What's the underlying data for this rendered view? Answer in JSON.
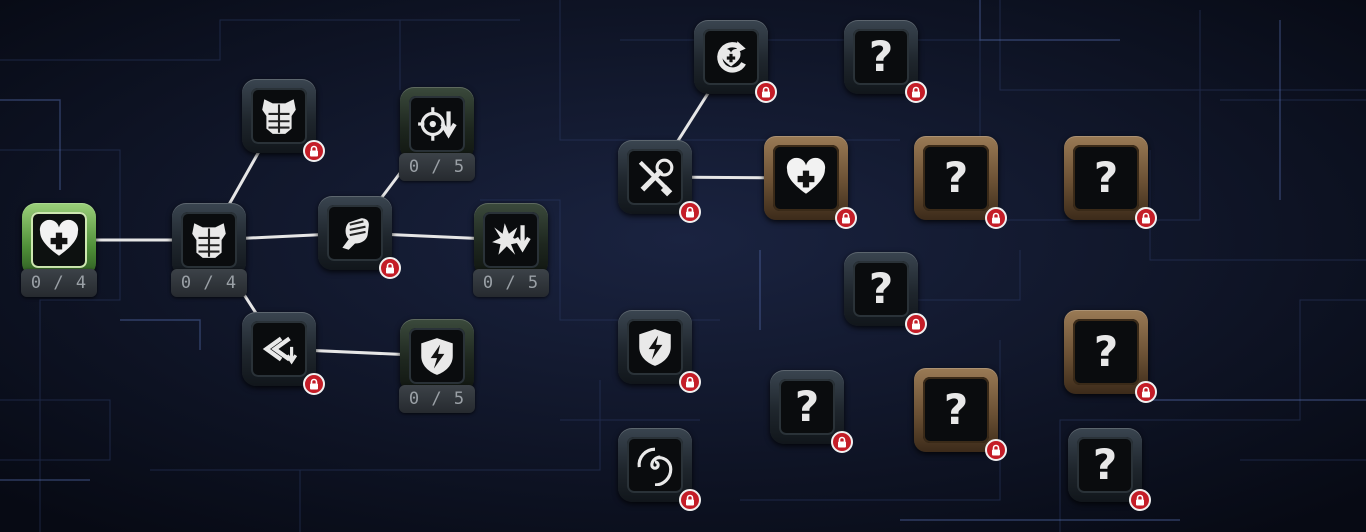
{
  "colors": {
    "background": "#0b1020",
    "connector": "#e6e6e6",
    "lock_badge": "#c41d27",
    "unlocked_frame": "#6fae4e",
    "tier2_frame": "#7a5c3b"
  },
  "skill_tree": {
    "nodes": [
      {
        "id": "n1",
        "icon": "heart-plus-icon",
        "frame": "green",
        "progress": "0 / 4",
        "locked": false
      },
      {
        "id": "n2",
        "icon": "armor-icon",
        "frame": "steel",
        "progress": "0 / 4",
        "locked": false
      },
      {
        "id": "n3",
        "icon": "armor-icon",
        "frame": "steel",
        "progress": null,
        "locked": true
      },
      {
        "id": "n4",
        "icon": "target-down-icon",
        "frame": "dark",
        "progress": "0 / 5",
        "locked": false
      },
      {
        "id": "n5",
        "icon": "fist-icon",
        "frame": "steel",
        "progress": null,
        "locked": true
      },
      {
        "id": "n6",
        "icon": "impact-down-icon",
        "frame": "dark",
        "progress": "0 / 5",
        "locked": false
      },
      {
        "id": "n7",
        "icon": "speed-down-icon",
        "frame": "steel",
        "progress": null,
        "locked": true
      },
      {
        "id": "n8",
        "icon": "shield-bolt-icon",
        "frame": "dark",
        "progress": "0 / 5",
        "locked": false
      },
      {
        "id": "n9",
        "icon": "heart-refresh-icon",
        "frame": "steel",
        "progress": null,
        "locked": true
      },
      {
        "id": "n10",
        "icon": "tools-icon",
        "frame": "steel",
        "progress": null,
        "locked": true
      },
      {
        "id": "n11",
        "icon": "heart-plus-icon",
        "frame": "bronze",
        "progress": null,
        "locked": true
      },
      {
        "id": "n12",
        "icon": "shield-bolt-icon",
        "frame": "steel",
        "progress": null,
        "locked": true
      },
      {
        "id": "n13",
        "icon": "vortex-icon",
        "frame": "steel",
        "progress": null,
        "locked": true
      },
      {
        "id": "n14",
        "icon": "question-icon",
        "frame": "steel",
        "progress": null,
        "locked": true,
        "label": "?"
      },
      {
        "id": "n15",
        "icon": "question-icon",
        "frame": "bronze",
        "progress": null,
        "locked": true,
        "label": "?"
      },
      {
        "id": "n16",
        "icon": "question-icon",
        "frame": "bronze",
        "progress": null,
        "locked": true,
        "label": "?"
      },
      {
        "id": "n17",
        "icon": "question-icon",
        "frame": "steel",
        "progress": null,
        "locked": true,
        "label": "?"
      },
      {
        "id": "n18",
        "icon": "question-icon",
        "frame": "steel",
        "progress": null,
        "locked": true,
        "label": "?"
      },
      {
        "id": "n19",
        "icon": "question-icon",
        "frame": "bronze",
        "progress": null,
        "locked": true,
        "label": "?"
      },
      {
        "id": "n20",
        "icon": "question-icon",
        "frame": "bronze",
        "progress": null,
        "locked": true,
        "label": "?"
      },
      {
        "id": "n21",
        "icon": "question-icon",
        "frame": "steel",
        "progress": null,
        "locked": true,
        "label": "?"
      }
    ],
    "links": [
      [
        "n1",
        "n2"
      ],
      [
        "n2",
        "n3"
      ],
      [
        "n2",
        "n5"
      ],
      [
        "n2",
        "n7"
      ],
      [
        "n5",
        "n4"
      ],
      [
        "n5",
        "n6"
      ],
      [
        "n7",
        "n8"
      ],
      [
        "n10",
        "n9"
      ],
      [
        "n10",
        "n11"
      ]
    ]
  }
}
